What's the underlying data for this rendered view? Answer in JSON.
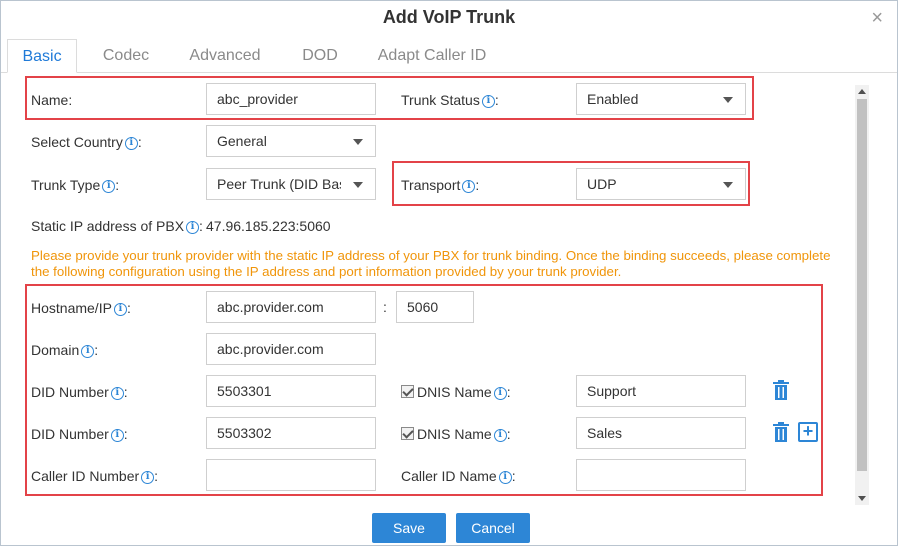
{
  "dialog": {
    "title": "Add VoIP Trunk",
    "close_symbol": "×"
  },
  "tabs": [
    {
      "label": "Basic",
      "active": true
    },
    {
      "label": "Codec"
    },
    {
      "label": "Advanced"
    },
    {
      "label": "DOD"
    },
    {
      "label": "Adapt Caller ID"
    }
  ],
  "form": {
    "name": {
      "label": "Name:",
      "value": "abc_provider"
    },
    "trunk_status": {
      "label": "Trunk Status",
      "suffix": ":",
      "value": "Enabled"
    },
    "select_country": {
      "label": "Select Country",
      "suffix": ":",
      "value": "General"
    },
    "trunk_type": {
      "label": "Trunk Type",
      "suffix": ":",
      "value": "Peer Trunk (DID Bas"
    },
    "transport": {
      "label": "Transport",
      "suffix": ":",
      "value": "UDP"
    },
    "static_ip": {
      "label": "Static IP address of PBX",
      "suffix": ":",
      "value": "47.96.185.223:5060"
    },
    "notice": "Please provide your trunk provider with the static IP address of your PBX for trunk binding. Once the binding succeeds, please complete the following configuration using the IP address and port information provided by your trunk provider.",
    "hostname": {
      "label": "Hostname/IP",
      "suffix": ":",
      "value": "abc.provider.com",
      "port_sep": ":",
      "port": "5060"
    },
    "domain": {
      "label": "Domain",
      "suffix": ":",
      "value": "abc.provider.com"
    },
    "did_rows": [
      {
        "label": "DID Number",
        "suffix": ":",
        "value": "5503301",
        "dnis_label": "DNIS Name",
        "dnis_suffix": ":",
        "dnis_value": "Support"
      },
      {
        "label": "DID Number",
        "suffix": ":",
        "value": "5503302",
        "dnis_label": "DNIS Name",
        "dnis_suffix": ":",
        "dnis_value": "Sales"
      }
    ],
    "caller_id_number": {
      "label": "Caller ID Number",
      "suffix": ":",
      "value": ""
    },
    "caller_id_name": {
      "label": "Caller ID Name",
      "suffix": ":",
      "value": ""
    },
    "info_symbol": "i",
    "plus_symbol": "+"
  },
  "buttons": {
    "save": "Save",
    "cancel": "Cancel"
  },
  "colors": {
    "accent": "#2d86d6",
    "highlight": "#e34348",
    "notice": "#f0950a"
  }
}
